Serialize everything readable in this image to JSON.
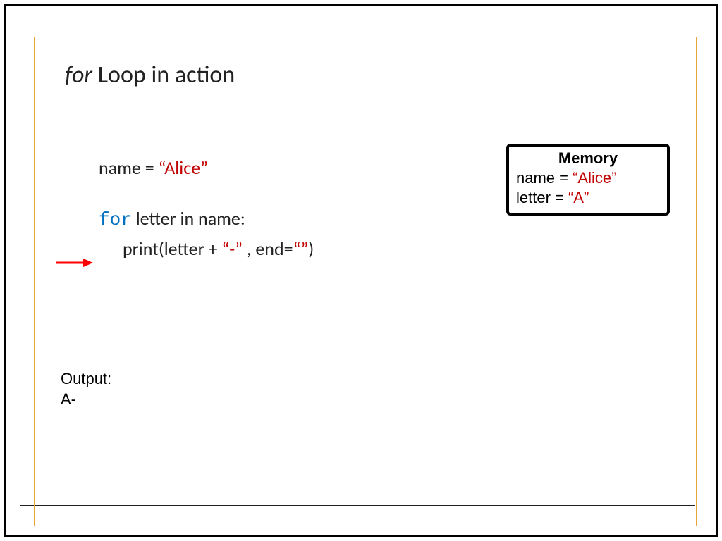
{
  "title": {
    "for": "for",
    "rest": " Loop in action"
  },
  "code": {
    "line1_var": "name = ",
    "line1_val": "“Alice”",
    "line2_for": "for",
    "line2_rest": " letter in name:",
    "line3_pre": "print(letter + ",
    "line3_dash": "“-”",
    "line3_mid": " , end=",
    "line3_empty": "“”",
    "line3_end": ")"
  },
  "memory": {
    "title": "Memory",
    "row1_label": "name = ",
    "row1_val": "“Alice”",
    "row2_label": "letter = ",
    "row2_val": "“A”"
  },
  "output": {
    "label": "Output:",
    "value": "A-"
  }
}
